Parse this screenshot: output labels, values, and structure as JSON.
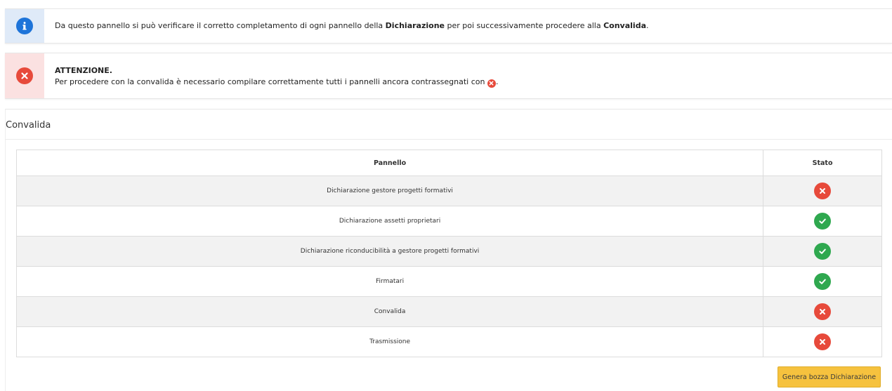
{
  "info_alert": {
    "text_prefix": "Da questo pannello si può verificare il corretto completamento di ogni pannello della ",
    "bold1": "Dichiarazione",
    "text_middle": " per poi successivamente procedere alla ",
    "bold2": "Convalida",
    "text_suffix": ".",
    "icon": "info-icon"
  },
  "error_alert": {
    "title": "ATTENZIONE.",
    "message": "Per procedere con la convalida è necessario compilare correttamente tutti i pannelli ancora contrassegnati con ",
    "message_suffix": ".",
    "icon": "error-x-icon"
  },
  "panel": {
    "title": "Convalida",
    "table": {
      "headers": [
        "Pannello",
        "Stato"
      ],
      "rows": [
        {
          "name": "Dichiarazione gestore progetti formativi",
          "status": "error"
        },
        {
          "name": "Dichiarazione assetti proprietari",
          "status": "ok"
        },
        {
          "name": "Dichiarazione riconducibilità a gestore progetti formativi",
          "status": "ok"
        },
        {
          "name": "Firmatari",
          "status": "ok"
        },
        {
          "name": "Convalida",
          "status": "error"
        },
        {
          "name": "Trasmissione",
          "status": "error"
        }
      ]
    },
    "button_label": "Genera bozza Dichiarazione"
  },
  "colors": {
    "info_blue": "#1e74d9",
    "error_red": "#e74a3b",
    "ok_green": "#2fa84f",
    "button_yellow": "#f6c23e"
  }
}
